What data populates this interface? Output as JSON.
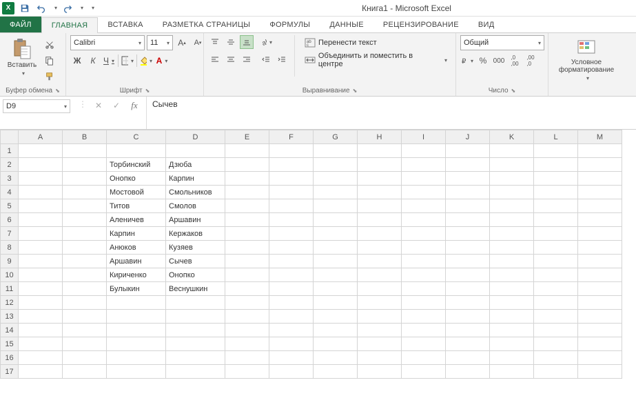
{
  "app_title": "Книга1 - Microsoft Excel",
  "tabs": {
    "file": "ФАЙЛ",
    "home": "ГЛАВНАЯ",
    "insert": "ВСТАВКА",
    "layout": "РАЗМЕТКА СТРАНИЦЫ",
    "formulas": "ФОРМУЛЫ",
    "data": "ДАННЫЕ",
    "review": "РЕЦЕНЗИРОВАНИЕ",
    "view": "ВИД"
  },
  "ribbon": {
    "clipboard": {
      "paste": "Вставить",
      "label": "Буфер обмена"
    },
    "font": {
      "name": "Calibri",
      "size": "11",
      "label": "Шрифт",
      "bold": "Ж",
      "italic": "К",
      "underline": "Ч"
    },
    "align": {
      "wrap": "Перенести текст",
      "merge": "Объединить и поместить в центре",
      "label": "Выравнивание"
    },
    "number": {
      "format": "Общий",
      "label": "Число"
    },
    "styles": {
      "condfmt": "Условное форматирование",
      "label": ""
    }
  },
  "namebox": "D9",
  "formula": "Сычев",
  "columns": [
    "A",
    "B",
    "C",
    "D",
    "E",
    "F",
    "G",
    "H",
    "I",
    "J",
    "K",
    "L",
    "M"
  ],
  "rows": 17,
  "cells": {
    "C2": "Торбинский",
    "D2": "Дзюба",
    "C3": "Онопко",
    "D3": "Карпин",
    "C4": "Мостовой",
    "D4": "Смольников",
    "C5": "Титов",
    "D5": "Смолов",
    "C6": "Аленичев",
    "D6": "Аршавин",
    "C7": "Карпин",
    "D7": "Кержаков",
    "C8": "Анюков",
    "D8": "Кузяев",
    "C9": "Аршавин",
    "D9": "Сычев",
    "C10": "Кириченко",
    "D10": "Онопко",
    "C11": "Булыкин",
    "D11": "Веснушкин"
  }
}
